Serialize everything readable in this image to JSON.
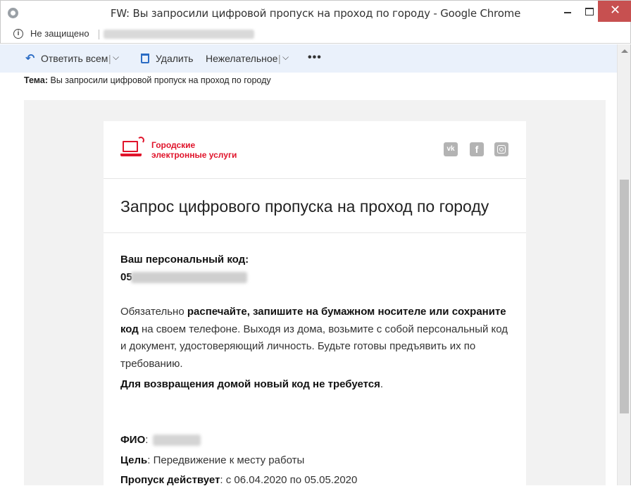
{
  "window": {
    "title": "FW: Вы запросили цифровой пропуск на проход по городу - Google Chrome",
    "close_glyph": "✕"
  },
  "addressbar": {
    "security_label": "Не защищено",
    "icon": "info-icon"
  },
  "toolbar": {
    "reply_all": "Ответить всем",
    "delete": "Удалить",
    "junk": "Нежелательное",
    "pipe": "|",
    "chevron": "⌵",
    "more": "•••"
  },
  "message": {
    "subject_label": "Тема:",
    "subject": "Вы запросили цифровой пропуск на проход по городу"
  },
  "email": {
    "brand_line1": "Городские",
    "brand_line2": "электронные услуги",
    "social": {
      "vk": "vk",
      "fb": "f"
    },
    "heading": "Запрос цифрового пропуска на проход по городу",
    "code_label": "Ваш персональный код:",
    "code_prefix": "05",
    "para_intro": "Обязательно ",
    "para_bold": "распечайте, запишите на бумажном носителе или сохраните код",
    "para_rest": " на своем телефоне. Выходя из дома, возьмите с собой персональный код и документ, удостоверяющий личность. Будьте готовы предъявить их по требованию.",
    "return_bold": "Для возвращения домой новый код не требуется",
    "return_end": ".",
    "fio_label": "ФИО",
    "goal_label": "Цель",
    "goal_value": ": Передвижение к месту работы",
    "valid_label": "Пропуск действует",
    "valid_value": ": с 06.04.2020 по 05.05.2020",
    "colon": ":"
  },
  "colors": {
    "accent": "#e0142b",
    "toolbar_bg": "#eaf1fb",
    "link_blue": "#2b6cc4"
  }
}
